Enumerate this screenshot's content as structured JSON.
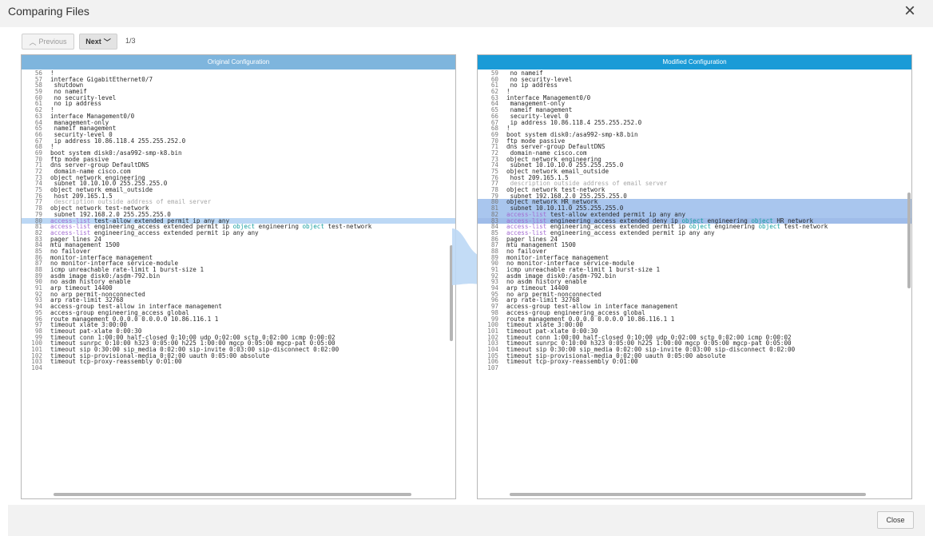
{
  "dialog": {
    "title": "Comparing Files",
    "close_icon": "×"
  },
  "nav": {
    "previous_label": "Previous",
    "next_label": "Next",
    "page_indicator": "1/3"
  },
  "left_panel": {
    "title": "Original Configuration",
    "lines": [
      {
        "n": "56",
        "text": "!"
      },
      {
        "n": "57",
        "text": "interface GigabitEthernet0/7"
      },
      {
        "n": "58",
        "text": " shutdown"
      },
      {
        "n": "59",
        "text": " no nameif"
      },
      {
        "n": "60",
        "text": " no security-level"
      },
      {
        "n": "61",
        "text": " no ip address"
      },
      {
        "n": "62",
        "text": "!"
      },
      {
        "n": "63",
        "text": "interface Management0/0"
      },
      {
        "n": "64",
        "text": " management-only"
      },
      {
        "n": "65",
        "text": " nameif management"
      },
      {
        "n": "66",
        "text": " security-level 0"
      },
      {
        "n": "67",
        "text": " ip address 10.86.118.4 255.255.252.0"
      },
      {
        "n": "68",
        "text": "!"
      },
      {
        "n": "69",
        "text": "boot system disk0:/asa992-smp-k8.bin"
      },
      {
        "n": "70",
        "text": "ftp mode passive"
      },
      {
        "n": "71",
        "text": "dns server-group DefaultDNS"
      },
      {
        "n": "72",
        "text": " domain-name cisco.com"
      },
      {
        "n": "73",
        "text": "object network engineering"
      },
      {
        "n": "74",
        "text": " subnet 10.10.10.0 255.255.255.0"
      },
      {
        "n": "75",
        "text": "object network email_outside"
      },
      {
        "n": "76",
        "text": " host 209.165.1.5"
      },
      {
        "n": "77",
        "text": " description outside address of email server",
        "type": "comment"
      },
      {
        "n": "78",
        "text": "object network test-network"
      },
      {
        "n": "79",
        "text": " subnet 192.168.2.0 255.255.255.0"
      },
      {
        "n": "80",
        "acl": "access-list",
        "text": " test-allow extended permit ip any any",
        "hl": "line"
      },
      {
        "n": "81",
        "acl": "access-list",
        "text": " engineering_access extended permit ip ",
        "obj1": "object",
        "mid": " engineering ",
        "obj2": "object",
        "tail": " test-network"
      },
      {
        "n": "82",
        "acl": "access-list",
        "text": " engineering_access extended permit ip any any"
      },
      {
        "n": "83",
        "text": "pager lines 24"
      },
      {
        "n": "84",
        "text": "mtu management 1500"
      },
      {
        "n": "85",
        "text": "no failover"
      },
      {
        "n": "86",
        "text": "monitor-interface management"
      },
      {
        "n": "87",
        "text": "no monitor-interface service-module"
      },
      {
        "n": "88",
        "text": "icmp unreachable rate-limit 1 burst-size 1"
      },
      {
        "n": "89",
        "text": "asdm image disk0:/asdm-792.bin"
      },
      {
        "n": "90",
        "text": "no asdm history enable"
      },
      {
        "n": "91",
        "text": "arp timeout 14400"
      },
      {
        "n": "92",
        "text": "no arp permit-nonconnected"
      },
      {
        "n": "93",
        "text": "arp rate-limit 32768"
      },
      {
        "n": "94",
        "text": "access-group test-allow in interface management"
      },
      {
        "n": "95",
        "text": "access-group engineering_access global"
      },
      {
        "n": "96",
        "text": "route management 0.0.0.0 0.0.0.0 10.86.116.1 1"
      },
      {
        "n": "97",
        "text": "timeout xlate 3:00:00"
      },
      {
        "n": "98",
        "text": "timeout pat-xlate 0:00:30"
      },
      {
        "n": "99",
        "text": "timeout conn 1:00:00 half-closed 0:10:00 udp 0:02:00 sctp 0:02:00 icmp 0:00:02"
      },
      {
        "n": "100",
        "text": "timeout sunrpc 0:10:00 h323 0:05:00 h225 1:00:00 mgcp 0:05:00 mgcp-pat 0:05:00"
      },
      {
        "n": "101",
        "text": "timeout sip 0:30:00 sip_media 0:02:00 sip-invite 0:03:00 sip-disconnect 0:02:00"
      },
      {
        "n": "102",
        "text": "timeout sip-provisional-media 0:02:00 uauth 0:05:00 absolute"
      },
      {
        "n": "103",
        "text": "timeout tcp-proxy-reassembly 0:01:00"
      },
      {
        "n": "104",
        "text": ""
      }
    ]
  },
  "right_panel": {
    "title": "Modified Configuration",
    "lines": [
      {
        "n": "59",
        "text": " no nameif"
      },
      {
        "n": "60",
        "text": " no security-level"
      },
      {
        "n": "61",
        "text": " no ip address"
      },
      {
        "n": "62",
        "text": "!"
      },
      {
        "n": "63",
        "text": "interface Management0/0"
      },
      {
        "n": "64",
        "text": " management-only"
      },
      {
        "n": "65",
        "text": " nameif management"
      },
      {
        "n": "66",
        "text": " security-level 0"
      },
      {
        "n": "67",
        "text": " ip address 10.86.118.4 255.255.252.0"
      },
      {
        "n": "68",
        "text": "!"
      },
      {
        "n": "69",
        "text": "boot system disk0:/asa992-smp-k8.bin"
      },
      {
        "n": "70",
        "text": "ftp mode passive"
      },
      {
        "n": "71",
        "text": "dns server-group DefaultDNS"
      },
      {
        "n": "72",
        "text": " domain-name cisco.com"
      },
      {
        "n": "73",
        "text": "object network engineering"
      },
      {
        "n": "74",
        "text": " subnet 10.10.10.0 255.255.255.0"
      },
      {
        "n": "75",
        "text": "object network email_outside"
      },
      {
        "n": "76",
        "text": " host 209.165.1.5"
      },
      {
        "n": "77",
        "text": " description outside address of email server",
        "type": "comment"
      },
      {
        "n": "78",
        "text": "object network test-network"
      },
      {
        "n": "79",
        "text": " subnet 192.168.2.0 255.255.255.0"
      },
      {
        "n": "80",
        "text": "object network HR_network",
        "hl": "added"
      },
      {
        "n": "81",
        "text": " subnet 10.10.11.0 255.255.255.0",
        "hl": "added"
      },
      {
        "n": "82",
        "acl": "access-list",
        "text": " test-allow extended permit ip any any",
        "hl": "added"
      },
      {
        "n": "83",
        "acl": "access-list",
        "text": " engineering_access extended deny ip ",
        "obj1": "object",
        "mid": " engineering ",
        "obj2": "object",
        "tail": " HR_network",
        "hl": "changed"
      },
      {
        "n": "84",
        "acl": "access-list",
        "text": " engineering_access extended permit ip ",
        "obj1": "object",
        "mid": " engineering ",
        "obj2": "object",
        "tail": " test-network"
      },
      {
        "n": "85",
        "acl": "access-list",
        "text": " engineering_access extended permit ip any any"
      },
      {
        "n": "86",
        "text": "pager lines 24"
      },
      {
        "n": "87",
        "text": "mtu management 1500"
      },
      {
        "n": "88",
        "text": "no failover"
      },
      {
        "n": "89",
        "text": "monitor-interface management"
      },
      {
        "n": "90",
        "text": "no monitor-interface service-module"
      },
      {
        "n": "91",
        "text": "icmp unreachable rate-limit 1 burst-size 1"
      },
      {
        "n": "92",
        "text": "asdm image disk0:/asdm-792.bin"
      },
      {
        "n": "93",
        "text": "no asdm history enable"
      },
      {
        "n": "94",
        "text": "arp timeout 14400"
      },
      {
        "n": "95",
        "text": "no arp permit-nonconnected"
      },
      {
        "n": "96",
        "text": "arp rate-limit 32768"
      },
      {
        "n": "97",
        "text": "access-group test-allow in interface management"
      },
      {
        "n": "98",
        "text": "access-group engineering_access global"
      },
      {
        "n": "99",
        "text": "route management 0.0.0.0 0.0.0.0 10.86.116.1 1"
      },
      {
        "n": "100",
        "text": "timeout xlate 3:00:00"
      },
      {
        "n": "101",
        "text": "timeout pat-xlate 0:00:30"
      },
      {
        "n": "102",
        "text": "timeout conn 1:00:00 half-closed 0:10:00 udp 0:02:00 sctp 0:02:00 icmp 0:00:02"
      },
      {
        "n": "103",
        "text": "timeout sunrpc 0:10:00 h323 0:05:00 h225 1:00:00 mgcp 0:05:00 mgcp-pat 0:05:00"
      },
      {
        "n": "104",
        "text": "timeout sip 0:30:00 sip_media 0:02:00 sip-invite 0:03:00 sip-disconnect 0:02:00"
      },
      {
        "n": "105",
        "text": "timeout sip-provisional-media 0:02:00 uauth 0:05:00 absolute"
      },
      {
        "n": "106",
        "text": "timeout tcp-proxy-reassembly 0:01:00"
      },
      {
        "n": "107",
        "text": ""
      }
    ]
  },
  "footer": {
    "close_label": "Close"
  },
  "colors": {
    "left_header": "#7eb5dd",
    "right_header": "#1a9bd7",
    "acl_keyword": "#a36bd1",
    "object_keyword": "#1aa0a0",
    "highlight": "#a9c6ee"
  }
}
